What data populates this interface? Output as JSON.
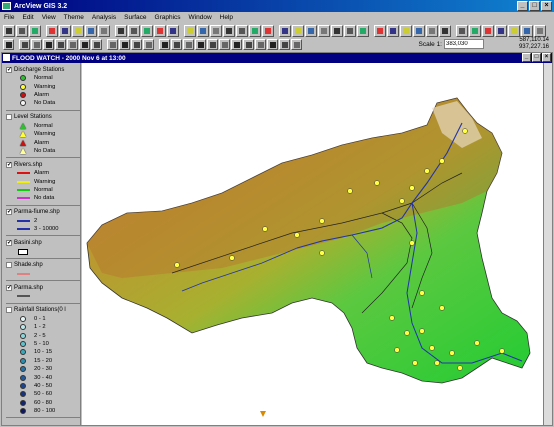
{
  "window": {
    "title": "ArcView GIS 3.2",
    "min": "_",
    "max": "□",
    "close": "×"
  },
  "menu": [
    "File",
    "Edit",
    "View",
    "Theme",
    "Analysis",
    "Surface",
    "Graphics",
    "Window",
    "Help"
  ],
  "toolbar": {
    "scale_label": "Scale 1:",
    "scale_value": "383,030",
    "coord_x": "587,110.14",
    "coord_y": "937,227.16"
  },
  "view": {
    "title": "FLOOD WATCH - 2000 Nov 6 at 13:00"
  },
  "toc": [
    {
      "name": "Discharge Stations",
      "checked": true,
      "items": [
        {
          "label": "Normal",
          "sym": "dot",
          "color": "#2fbf2f"
        },
        {
          "label": "Warning",
          "sym": "dot",
          "color": "#ffff33"
        },
        {
          "label": "Alarm",
          "sym": "dot",
          "color": "#cc1111"
        },
        {
          "label": "No Data",
          "sym": "dot",
          "color": "#f5f5f5"
        }
      ]
    },
    {
      "name": "Level Stations",
      "checked": false,
      "items": [
        {
          "label": "Normal",
          "sym": "tri",
          "color": "#2fbf2f"
        },
        {
          "label": "Warning",
          "sym": "tri",
          "color": "#ffff33"
        },
        {
          "label": "Alarm",
          "sym": "tri",
          "color": "#cc1111"
        },
        {
          "label": "No Data",
          "sym": "tri",
          "color": "#ffff99"
        }
      ]
    },
    {
      "name": "Rivers.shp",
      "checked": true,
      "items": [
        {
          "label": "Alarm",
          "sym": "line",
          "color": "#dd1111"
        },
        {
          "label": "Warning",
          "sym": "line",
          "color": "#eeee11"
        },
        {
          "label": "Normal",
          "sym": "line",
          "color": "#11cc11"
        },
        {
          "label": "No data",
          "sym": "line",
          "color": "#cc33cc"
        }
      ]
    },
    {
      "name": "Parma-fiume.shp",
      "checked": true,
      "items": [
        {
          "label": "2",
          "sym": "line",
          "color": "#2233aa"
        },
        {
          "label": "3 - 10000",
          "sym": "line",
          "color": "#2233aa"
        }
      ]
    },
    {
      "name": "Basini.shp",
      "checked": true,
      "items": [
        {
          "label": "",
          "sym": "box",
          "color": "#ffffff"
        }
      ]
    },
    {
      "name": "Shade.shp",
      "checked": false,
      "items": [
        {
          "label": "",
          "sym": "line",
          "color": "#e08080"
        }
      ]
    },
    {
      "name": "Parma.shp",
      "checked": true,
      "items": [
        {
          "label": "",
          "sym": "line",
          "color": "#555555"
        }
      ]
    },
    {
      "name": "Rainfall Stations(0 l",
      "checked": false,
      "items": [
        {
          "label": "0 - 1",
          "sym": "dot",
          "color": "#e6f7f7"
        },
        {
          "label": "1 - 2",
          "sym": "dot",
          "color": "#b9e8ea"
        },
        {
          "label": "2 - 5",
          "sym": "dot",
          "color": "#8ad6dc"
        },
        {
          "label": "5 - 10",
          "sym": "dot",
          "color": "#5cc2cc"
        },
        {
          "label": "10 - 15",
          "sym": "dot",
          "color": "#38a8bb"
        },
        {
          "label": "15 - 20",
          "sym": "dot",
          "color": "#2a8fb0"
        },
        {
          "label": "20 - 30",
          "sym": "dot",
          "color": "#2673a6"
        },
        {
          "label": "30 - 40",
          "sym": "dot",
          "color": "#215a9c"
        },
        {
          "label": "40 - 50",
          "sym": "dot",
          "color": "#1c4590"
        },
        {
          "label": "50 - 60",
          "sym": "dot",
          "color": "#173380"
        },
        {
          "label": "60 - 80",
          "sym": "dot",
          "color": "#122570"
        },
        {
          "label": "80 - 100",
          "sym": "dot",
          "color": "#0d1860"
        }
      ]
    }
  ]
}
